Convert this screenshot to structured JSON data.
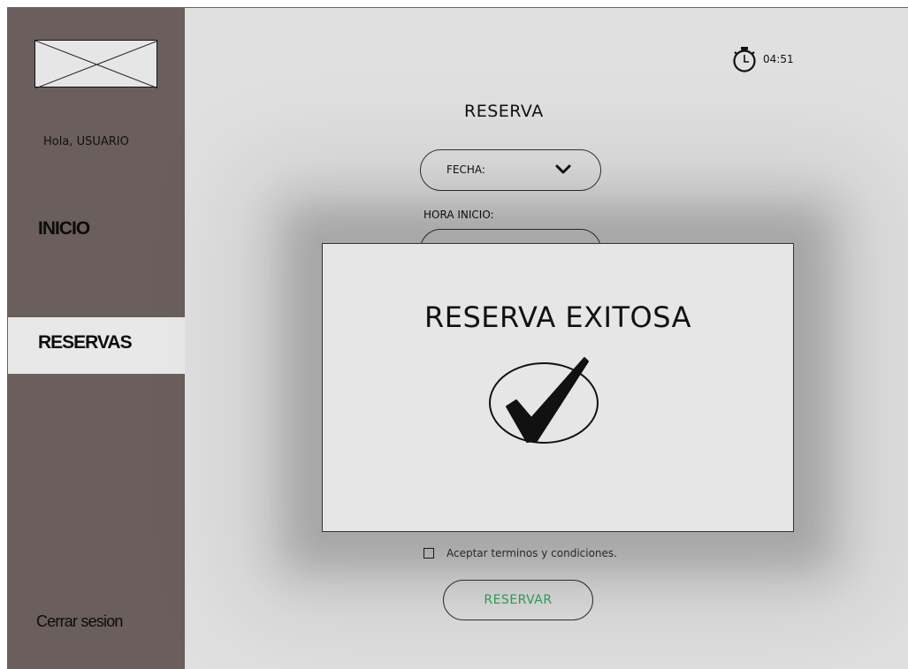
{
  "sidebar": {
    "greeting": "Hola, USUARIO",
    "items": [
      {
        "label": "INICIO"
      },
      {
        "label": "RESERVAS",
        "active": true
      }
    ],
    "logout_label": "Cerrar sesion"
  },
  "timer": {
    "text": "04:51",
    "icon": "stopwatch-icon"
  },
  "form": {
    "title": "RESERVA",
    "fecha_label": "FECHA:",
    "hora_inicio_label": "HORA INICIO:",
    "hora_inicio_value": "",
    "terms_label": "Aceptar terminos y condiciones.",
    "terms_checked": false,
    "submit_label": "RESERVAR"
  },
  "modal": {
    "title": "RESERVA EXITOSA",
    "icon": "checkmark-icon"
  },
  "colors": {
    "sidebar_bg": "#6a5f5c",
    "content_bg": "#e0e0e0",
    "submit_text": "#2aa85a"
  }
}
